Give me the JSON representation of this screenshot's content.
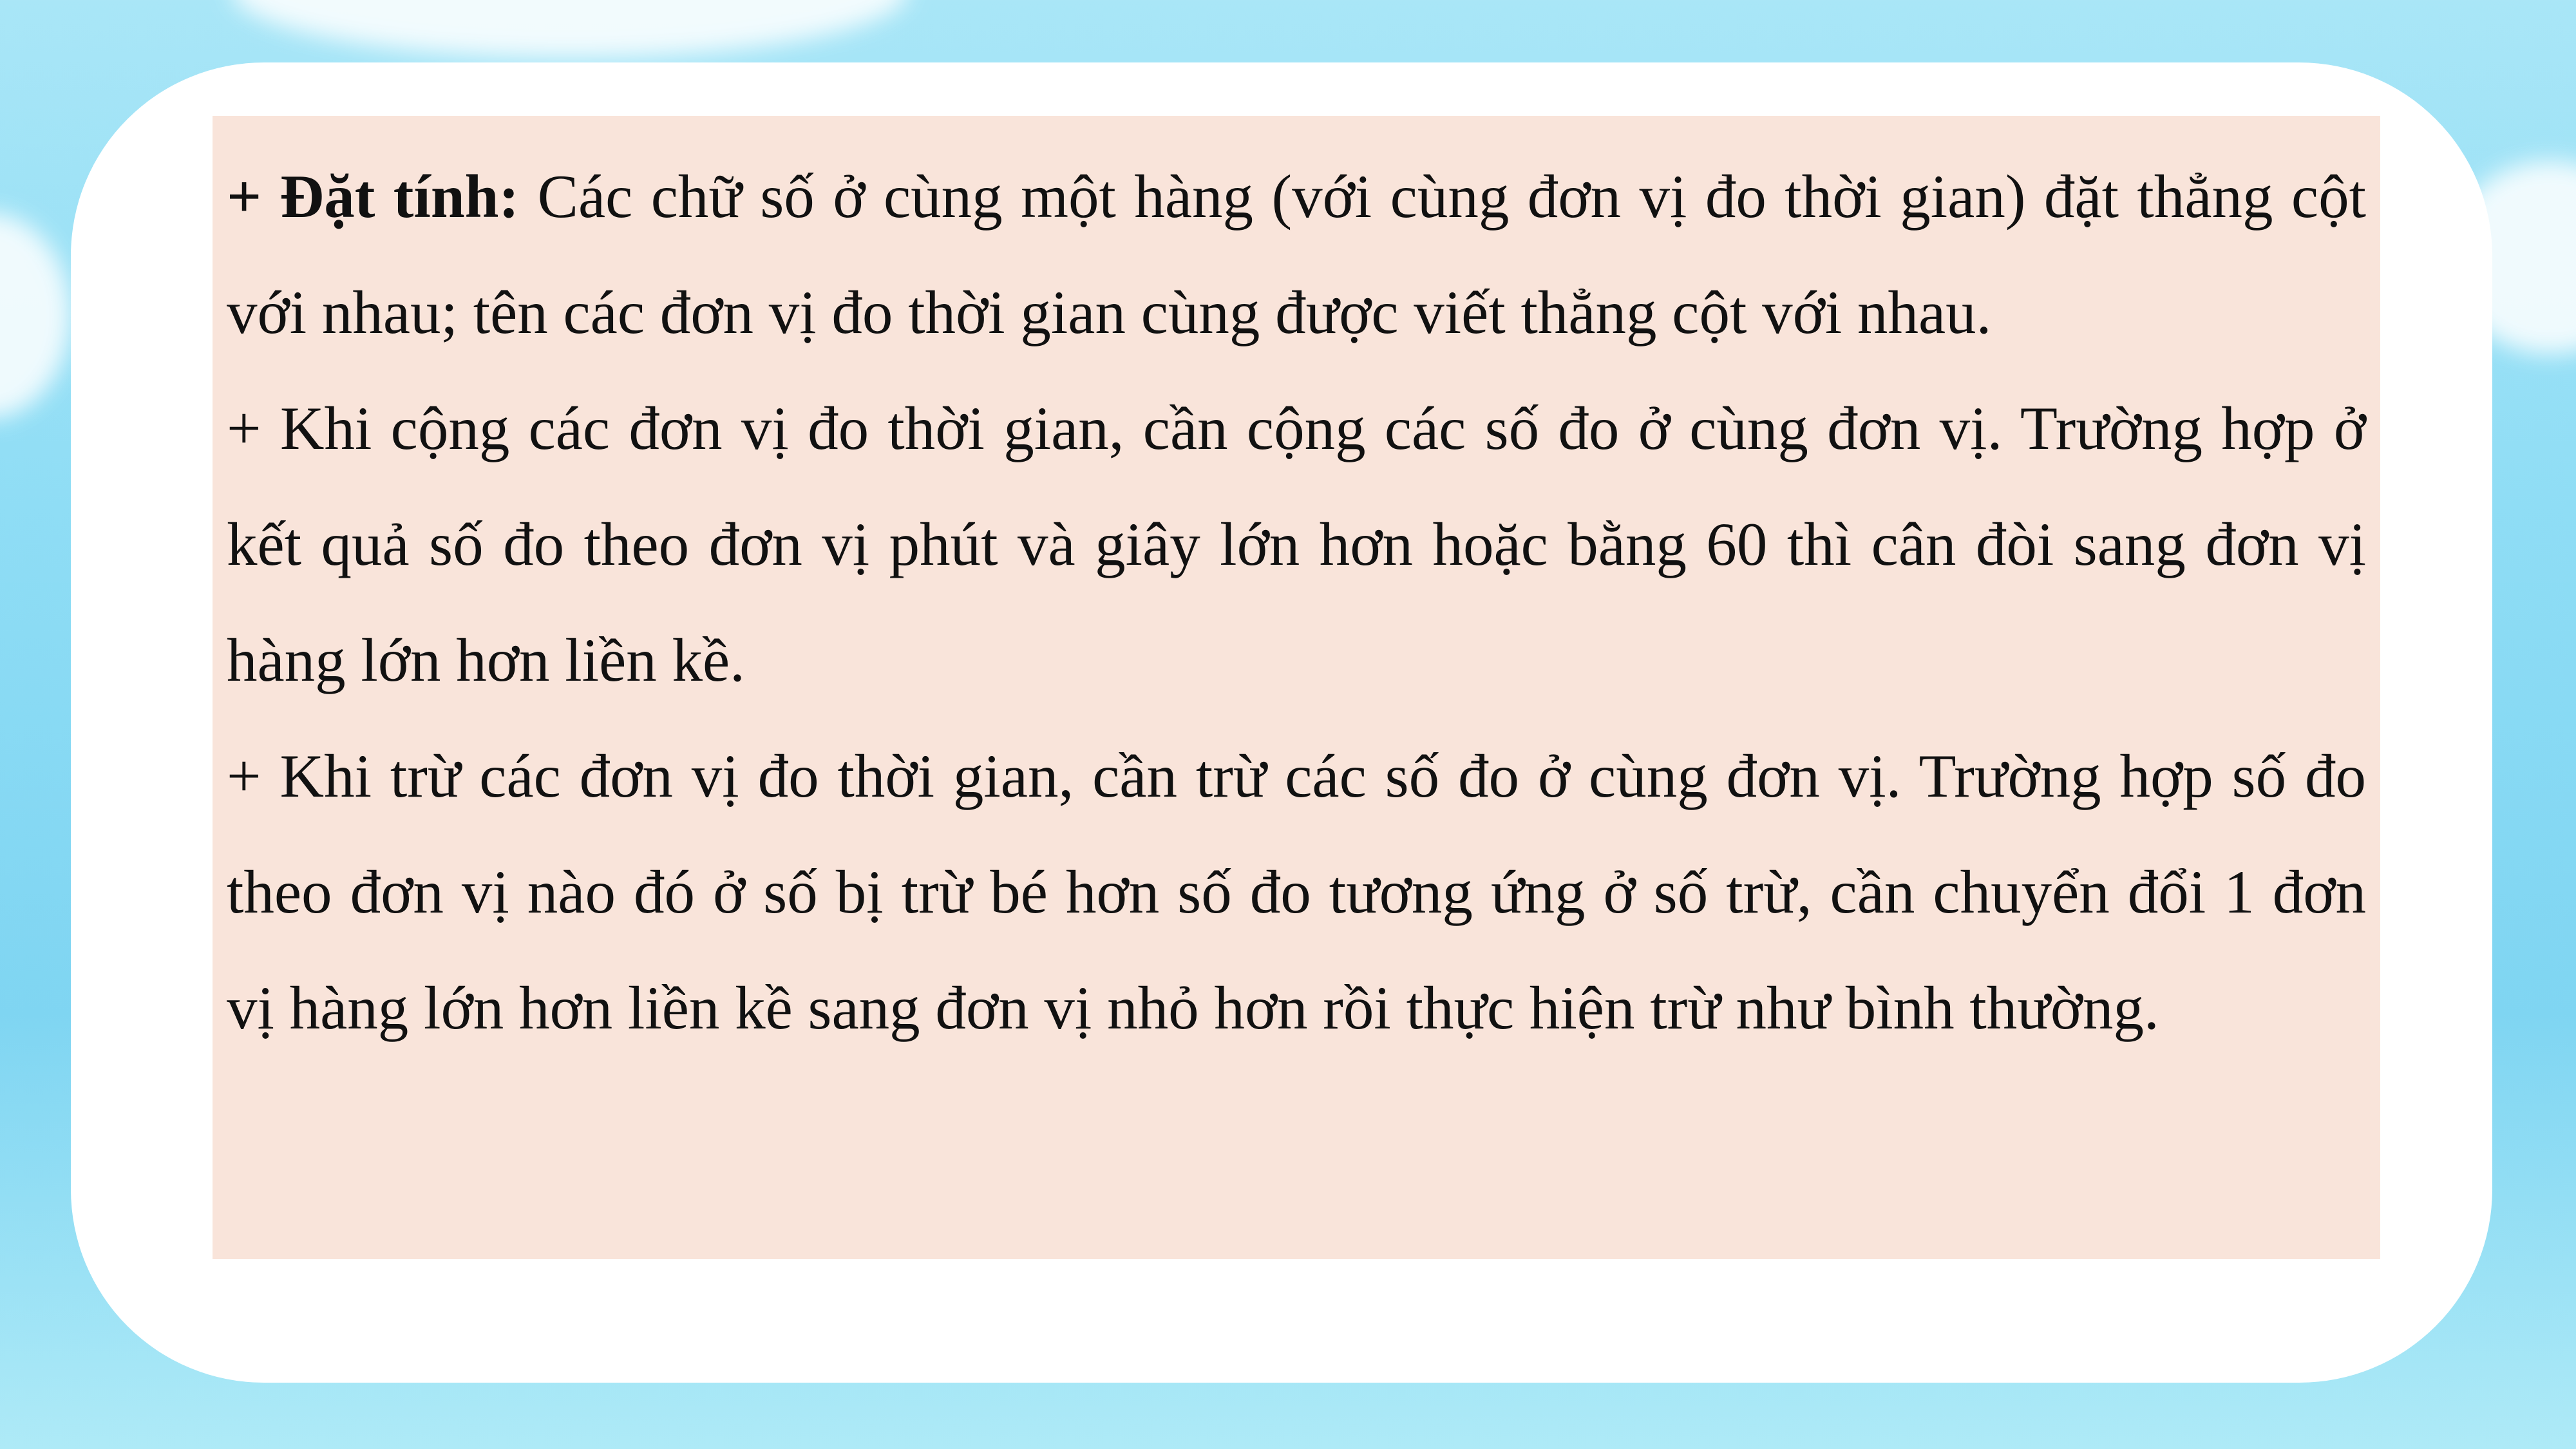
{
  "paragraphs": [
    {
      "bold": "+ Đặt tính:",
      "text": " Các chữ số ở cùng một hàng (với cùng đơn vị đo thời gian) đặt thẳng cột với nhau; tên các đơn vị đo thời gian cùng được viết thẳng cột với nhau."
    },
    {
      "text": "+ Khi cộng các đơn vị đo thời gian, cần cộng các số đo ở cùng đơn vị. Trường hợp ở kết quả số đo theo đơn vị phút và giây lớn hơn hoặc bằng 60 thì cân đòi sang đơn vị hàng lớn hơn liền kề."
    },
    {
      "text": "+ Khi trừ các đơn vị đo thời gian, cần trừ các số đo ở cùng đơn vị. Trường hợp số đo theo đơn vị nào đó ở số bị trừ bé hơn số đo tương ứng ở số trừ, cần chuyển đổi 1 đơn vị hàng lớn hơn liền kề sang đơn vị nhỏ hơn rồi thực hiện trừ như bình thường."
    }
  ]
}
